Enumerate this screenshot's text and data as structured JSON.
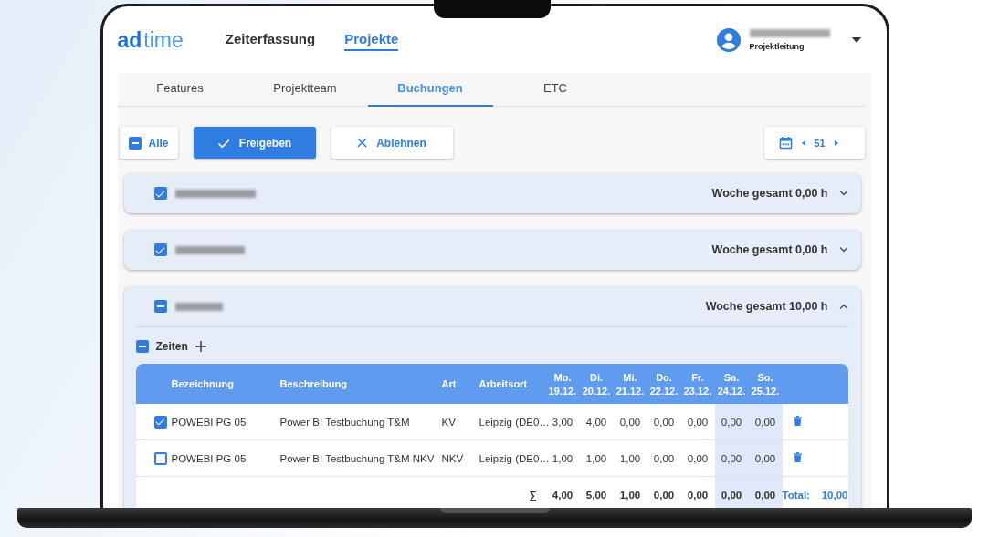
{
  "header": {
    "logo": {
      "bold": "ad",
      "light": "time"
    },
    "nav": [
      {
        "label": "Zeiterfassung",
        "selected": false
      },
      {
        "label": "Projekte",
        "selected": true
      }
    ],
    "user": {
      "role": "Projektleitung"
    }
  },
  "tabs": [
    {
      "label": "Features",
      "selected": false
    },
    {
      "label": "Projektteam",
      "selected": false
    },
    {
      "label": "Buchungen",
      "selected": true
    },
    {
      "label": "ETC",
      "selected": false
    }
  ],
  "toolbar": {
    "select_all": {
      "label": "Alle",
      "kind": "mixed",
      "checked": true
    },
    "buttons": [
      {
        "label": "Freigeben",
        "kind": "primary"
      },
      {
        "label": "Ablehnen",
        "kind": "reject"
      }
    ],
    "week": "51"
  },
  "employees": [
    {
      "kind": "tick",
      "checked": true,
      "total": "Woche gesamt 0,00 h",
      "expanded": false
    },
    {
      "kind": "tick",
      "checked": true,
      "total": "Woche gesamt 0,00 h",
      "expanded": false
    },
    {
      "kind": "mixed",
      "checked": true,
      "total": "Woche gesamt 10,00 h",
      "expanded": true,
      "section": {
        "label": "Zeiten",
        "kind": "mixed",
        "checked": true
      },
      "table": {
        "columns": [
          {
            "label": "Bezeichnung"
          },
          {
            "label": "Beschreibung"
          },
          {
            "label": "Art"
          },
          {
            "label": "Arbeitsort"
          },
          {
            "label": "Mo.",
            "date": "19.12.",
            "weekend": false
          },
          {
            "label": "Di.",
            "date": "20.12.",
            "weekend": false
          },
          {
            "label": "Mi.",
            "date": "21.12.",
            "weekend": false
          },
          {
            "label": "Do.",
            "date": "22.12.",
            "weekend": false
          },
          {
            "label": "Fr.",
            "date": "23.12.",
            "weekend": false
          },
          {
            "label": "Sa.",
            "date": "24.12.",
            "weekend": true
          },
          {
            "label": "So.",
            "date": "25.12.",
            "weekend": true
          }
        ],
        "rows": [
          {
            "checked": true,
            "cells": [
              "POWEBI PG 05",
              "Power BI Testbuchung T&M",
              "KV",
              "Leipzig (DE0…",
              "3,00",
              "4,00",
              "0,00",
              "0,00",
              "0,00",
              "0,00",
              "0,00"
            ]
          },
          {
            "checked": false,
            "cells": [
              "POWEBI PG 05",
              "Power BI Testbuchung T&M NKV",
              "NKV",
              "Leipzig (DE0…",
              "1,00",
              "1,00",
              "1,00",
              "0,00",
              "0,00",
              "0,00",
              "0,00"
            ]
          }
        ],
        "footer": {
          "symbol": "∑",
          "values": [
            "4,00",
            "5,00",
            "1,00",
            "0,00",
            "0,00",
            "0,00",
            "0,00"
          ],
          "total_label": "Total:",
          "total": "10,00"
        }
      }
    }
  ]
}
